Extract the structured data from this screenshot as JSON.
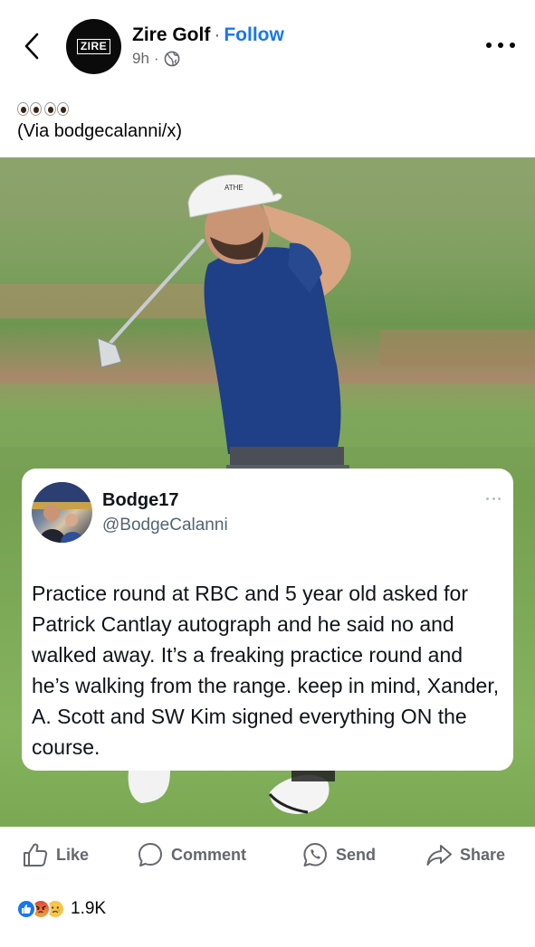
{
  "header": {
    "page_name": "Zire Golf",
    "separator": "·",
    "follow_label": "Follow",
    "time": "9h",
    "time_separator": "·",
    "avatar_logo_text": "ZIRE",
    "visibility_icon": "globe-icon"
  },
  "caption": {
    "emoji": "👀👀",
    "text": "(Via bodgecalanni/x)"
  },
  "photo": {
    "cap_logo": "ATHE",
    "tweet": {
      "display_name": "Bodge17",
      "handle": "@BodgeCalanni",
      "text": "Practice round at RBC and 5 year old asked for Patrick Cantlay autograph and he said no and walked away. It’s a freaking practice round and he’s walking from the range. keep in mind, Xander, A. Scott and SW Kim signed everything ON the course."
    }
  },
  "actions": {
    "like": "Like",
    "comment": "Comment",
    "send": "Send",
    "share": "Share"
  },
  "reactions": {
    "count": "1.9K",
    "icons": [
      "like-reaction-icon",
      "angry-reaction-icon",
      "sad-reaction-icon"
    ]
  },
  "colors": {
    "follow": "#1877f2",
    "secondary_text": "#65676b",
    "like_blue": "#1877f2"
  }
}
